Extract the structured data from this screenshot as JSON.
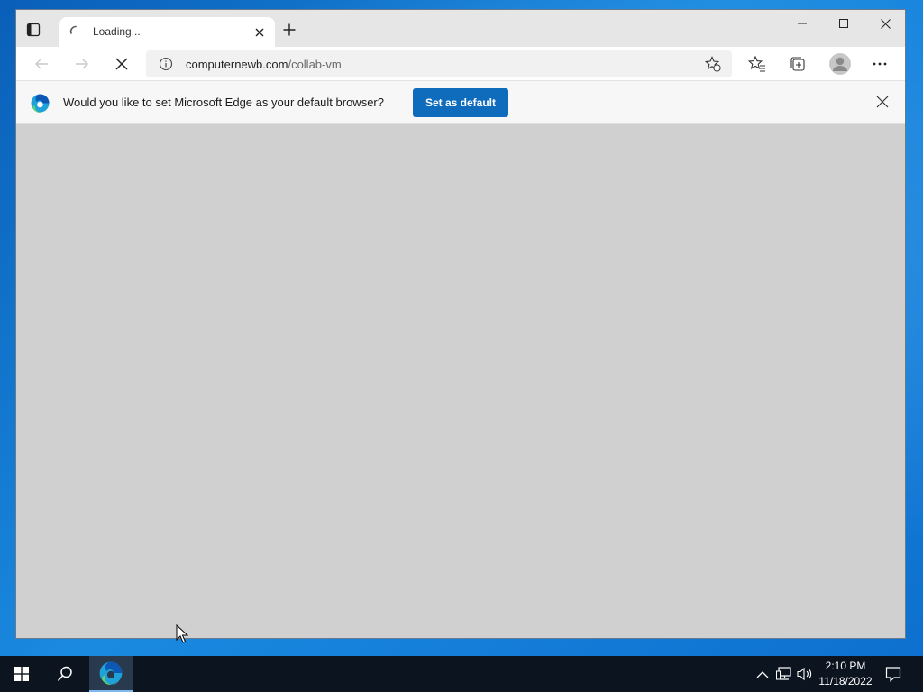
{
  "browser": {
    "tab": {
      "title": "Loading..."
    },
    "address": {
      "domain": "computernewb.com",
      "path": "/collab-vm"
    },
    "infobar": {
      "message": "Would you like to set Microsoft Edge as your default browser?",
      "button_label": "Set as default"
    }
  },
  "taskbar": {
    "clock": {
      "time": "2:10 PM",
      "date": "11/18/2022"
    }
  },
  "colors": {
    "accent": "#0f6cbd",
    "desktop": "#0a5fb8",
    "taskbar": "#0c1420",
    "content": "#d0d0d0"
  },
  "icons": [
    "tab-actions-icon",
    "loading-spinner-icon",
    "close-icon",
    "plus-icon",
    "minimize-icon",
    "maximize-icon",
    "back-arrow-icon",
    "forward-arrow-icon",
    "stop-icon",
    "info-icon",
    "add-favorite-icon",
    "favorites-icon",
    "collections-icon",
    "profile-icon",
    "more-icon",
    "edge-logo-icon",
    "windows-start-icon",
    "search-icon",
    "chevron-up-icon",
    "network-icon",
    "volume-icon",
    "notification-icon",
    "mouse-pointer-icon"
  ]
}
